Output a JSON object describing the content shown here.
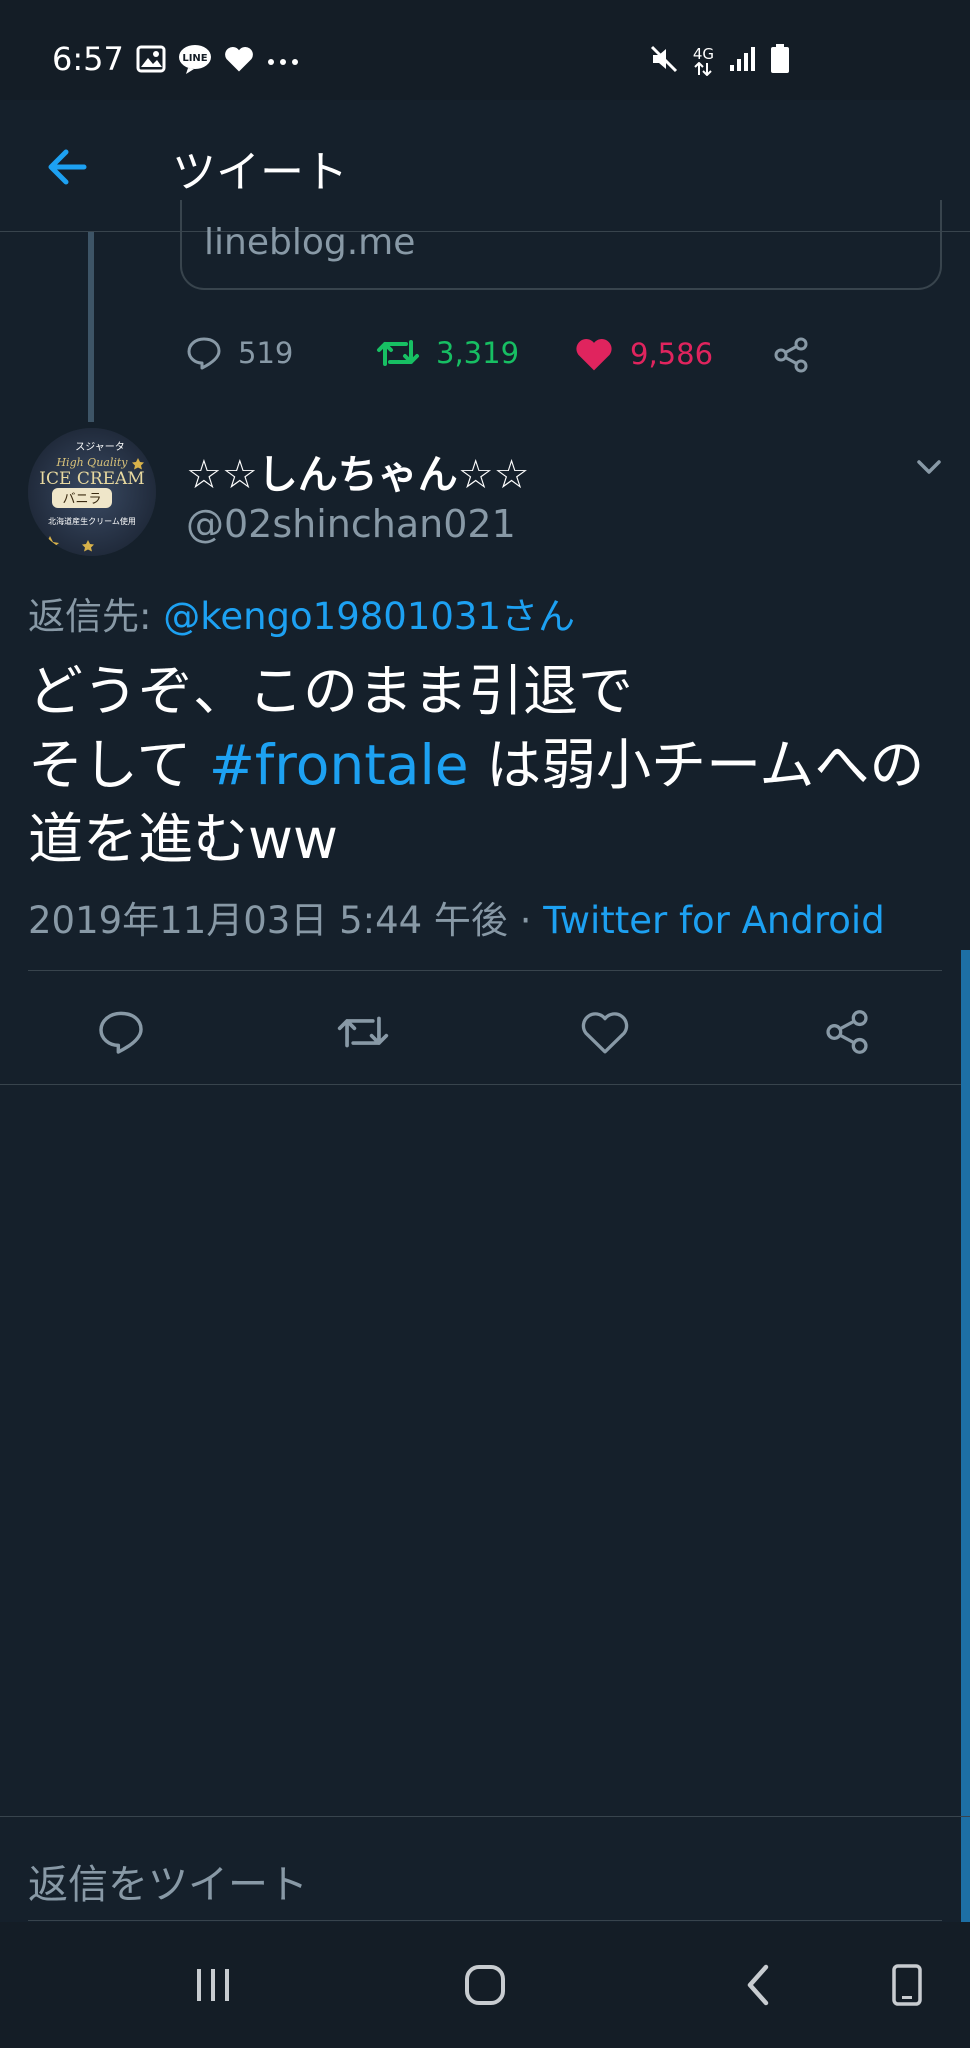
{
  "status_bar": {
    "time": "6:57",
    "left_icons": [
      "image-icon",
      "line-icon",
      "heart-icon",
      "more-icon"
    ],
    "right_icons": [
      "mute-icon",
      "4g-icon",
      "signal-icon",
      "battery-icon"
    ],
    "network_label": "4G"
  },
  "header": {
    "title": "ツイート",
    "back_icon": "arrow-left-icon"
  },
  "previous_tweet": {
    "link_domain": "lineblog.me",
    "replies": "519",
    "retweets": "3,319",
    "likes": "9,586"
  },
  "tweet": {
    "display_name": "☆☆しんちゃん☆☆",
    "handle": "@02shinchan021",
    "avatar_text_brand": "スジャータ",
    "avatar_text_quality": "High Quality",
    "avatar_text_main": "ICE CREAM",
    "avatar_text_flavor": "バニラ",
    "avatar_text_bottom": "北海道産生クリーム使用",
    "reply_prefix": "返信先:",
    "reply_mention": "@kengo19801031さん",
    "text_line1": "どうぞ、このまま引退で",
    "text_line2_pre": "そして ",
    "hashtag": "#frontale",
    "text_line2_post": " は弱小チームへの",
    "text_line3": "道を進むww",
    "timestamp": "2019年11月03日 5:44 午後 · ",
    "source": "Twitter for Android"
  },
  "composer": {
    "placeholder": "返信をツイート"
  },
  "colors": {
    "background": "#15202b",
    "accent": "#1da1f2",
    "retweet_green": "#17bf63",
    "like_red": "#e0245e",
    "secondary_text": "#8899a6"
  }
}
